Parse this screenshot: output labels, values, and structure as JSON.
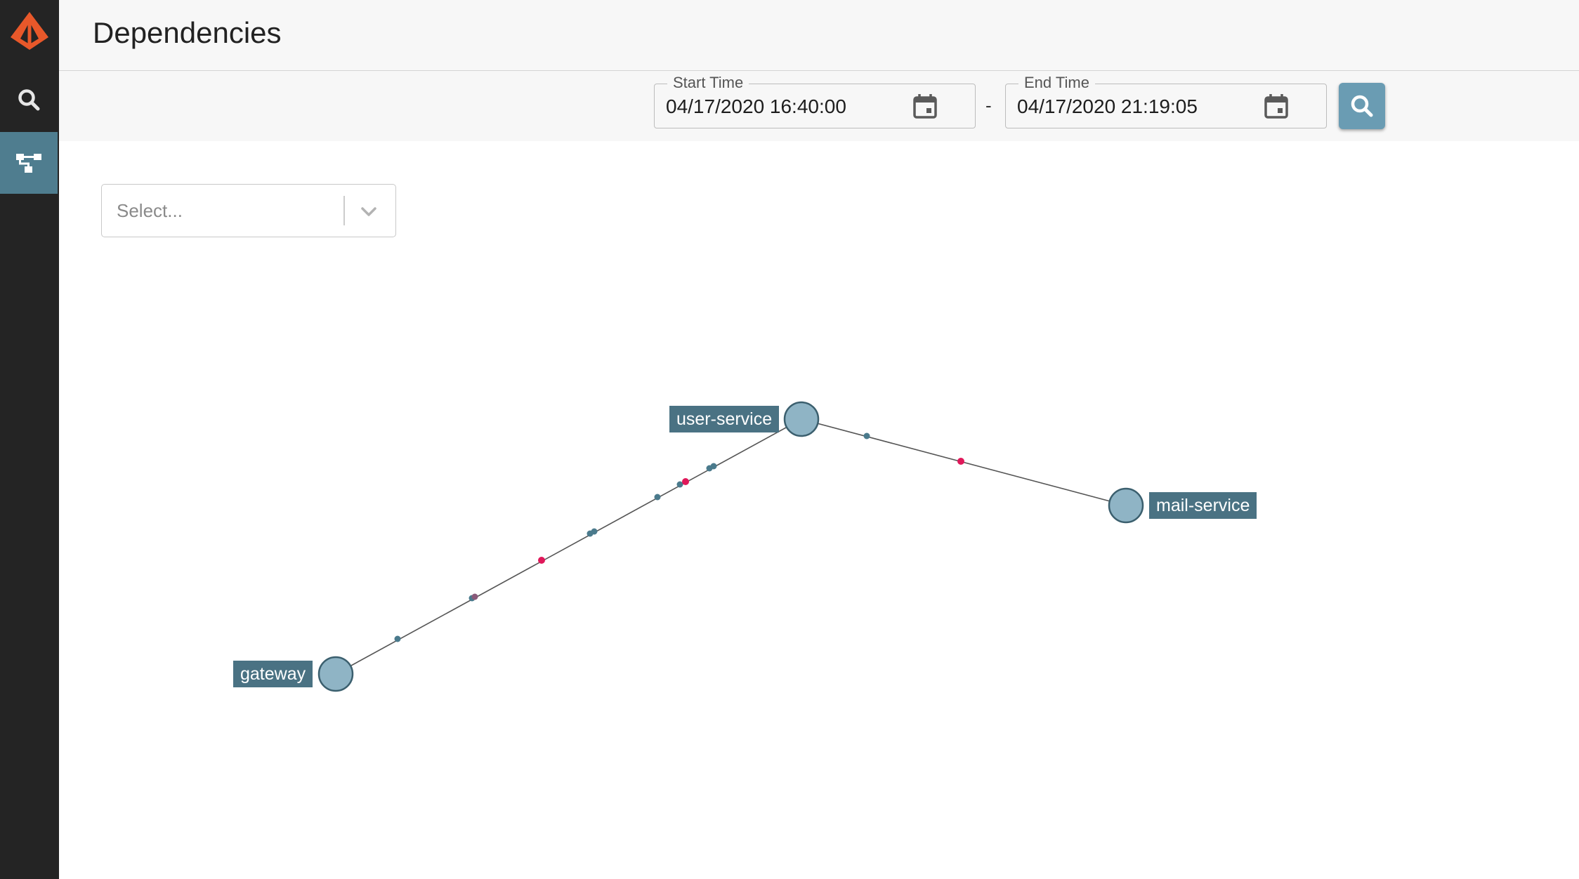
{
  "header": {
    "title": "Dependencies"
  },
  "sidebar": {
    "logo_icon": "zipkin-logo-icon",
    "items": [
      {
        "name": "search",
        "icon": "search-icon",
        "active": false
      },
      {
        "name": "dependencies",
        "icon": "dependency-tree-icon",
        "active": true
      }
    ],
    "active_color": "#4f7d8f"
  },
  "toolbar": {
    "start_time": {
      "label": "Start Time",
      "value": "04/17/2020 16:40:00"
    },
    "separator": "-",
    "end_time": {
      "label": "End Time",
      "value": "04/17/2020 21:19:05"
    },
    "search_button_icon": "search-icon",
    "search_button_color": "#6a9cb3"
  },
  "filter": {
    "placeholder": "Select..."
  },
  "graph": {
    "nodes": [
      {
        "id": "gateway",
        "label": "gateway"
      },
      {
        "id": "user-service",
        "label": "user-service"
      },
      {
        "id": "mail-service",
        "label": "mail-service"
      }
    ],
    "edges": [
      {
        "from": "gateway",
        "to": "user-service"
      },
      {
        "from": "user-service",
        "to": "mail-service"
      }
    ],
    "colors": {
      "node_fill": "#8fb4c5",
      "node_stroke": "#3b5f6e",
      "label_bg": "#4a7283",
      "edge": "#555555",
      "normal_particle": "#4a7a8c",
      "error_particle": "#e0185a"
    }
  }
}
